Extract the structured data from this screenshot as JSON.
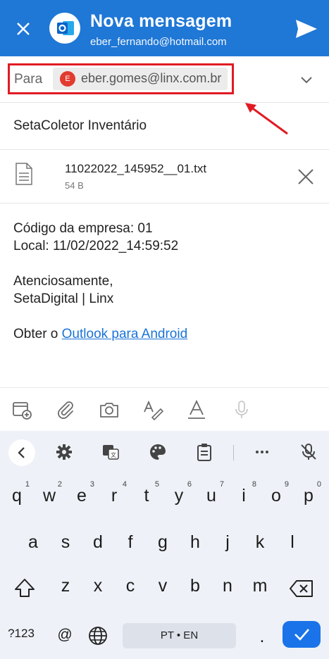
{
  "header": {
    "title": "Nova mensagem",
    "account": "eber_fernando@hotmail.com"
  },
  "to": {
    "label": "Para",
    "recipient_initial": "E",
    "recipient": "eber.gomes@linx.com.br"
  },
  "subject": "SetaColetor Inventário",
  "attachment": {
    "name": "11022022_145952__01.txt",
    "size": "54 B"
  },
  "body": {
    "line1": "Código da empresa: 01",
    "line2": "Local: 11/02/2022_14:59:52",
    "line3": "Atenciosamente,",
    "line4": "SetaDigital | Linx",
    "line5_prefix": "Obter o ",
    "line5_link": "Outlook para Android"
  },
  "keyboard": {
    "row1": [
      {
        "key": "q",
        "num": "1"
      },
      {
        "key": "w",
        "num": "2"
      },
      {
        "key": "e",
        "num": "3"
      },
      {
        "key": "r",
        "num": "4"
      },
      {
        "key": "t",
        "num": "5"
      },
      {
        "key": "y",
        "num": "6"
      },
      {
        "key": "u",
        "num": "7"
      },
      {
        "key": "i",
        "num": "8"
      },
      {
        "key": "o",
        "num": "9"
      },
      {
        "key": "p",
        "num": "0"
      }
    ],
    "row2": [
      "a",
      "s",
      "d",
      "f",
      "g",
      "h",
      "j",
      "k",
      "l"
    ],
    "row3": [
      "z",
      "x",
      "c",
      "v",
      "b",
      "n",
      "m"
    ],
    "symbols_key": "?123",
    "at_key": "@",
    "space_label": "PT • EN",
    "period_key": "."
  },
  "colors": {
    "header_bg": "#1f77d6",
    "highlight_border": "#e01b24",
    "link": "#1a73d9",
    "enter_key": "#1a73e8"
  }
}
